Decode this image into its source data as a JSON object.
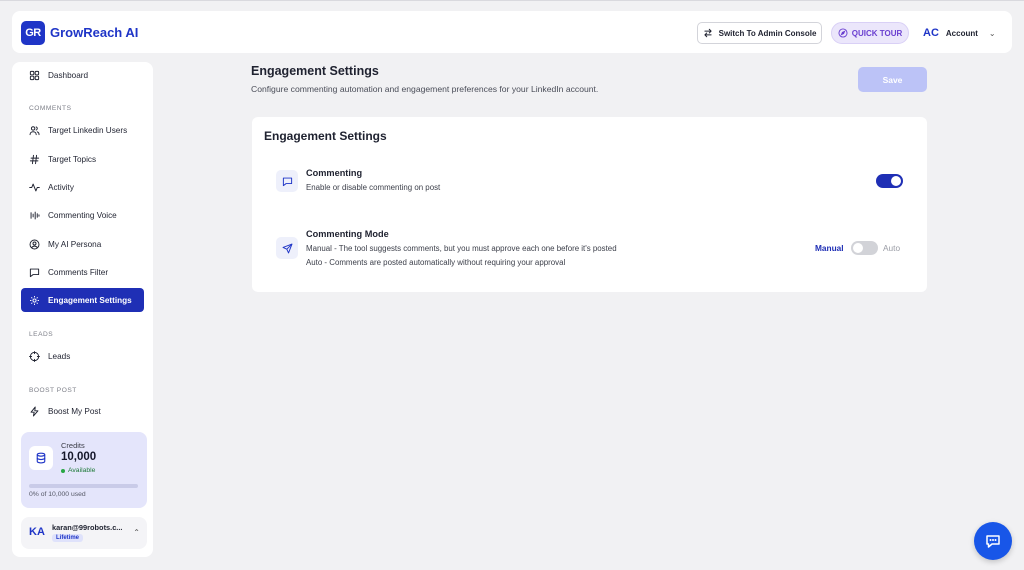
{
  "header": {
    "logo_text": "GR",
    "app_name": "GrowReach AI",
    "admin_console_label": "Switch To Admin Console",
    "quick_tour_label": "QUICK TOUR",
    "account_initials": "AC",
    "account_label": "Account"
  },
  "sidebar": {
    "dashboard": "Dashboard",
    "sections": {
      "comments": "COMMENTS",
      "leads": "LEADS",
      "boost": "BOOST POST"
    },
    "items": {
      "target_users": "Target Linkedin Users",
      "target_topics": "Target Topics",
      "activity": "Activity",
      "commenting_voice": "Commenting Voice",
      "ai_persona": "My AI Persona",
      "comments_filter": "Comments Filter",
      "engagement_settings": "Engagement Settings",
      "leads": "Leads",
      "boost_my_post": "Boost My Post"
    },
    "credits": {
      "title": "Credits",
      "value": "10,000",
      "status": "Available",
      "usage_text": "0% of 10,000 used",
      "usage_fraction": 0.0
    },
    "user": {
      "initials": "KA",
      "email": "karan@99robots.c...",
      "plan": "Lifetime"
    }
  },
  "main": {
    "title": "Engagement Settings",
    "subtitle": "Configure commenting automation and engagement preferences for your LinkedIn account.",
    "save_label": "Save",
    "card": {
      "title": "Engagement Settings",
      "commenting": {
        "title": "Commenting",
        "description": "Enable or disable commenting on post",
        "enabled": true
      },
      "mode": {
        "title": "Commenting Mode",
        "line1": "Manual - The tool suggests comments, but you must approve each one before it's posted",
        "line2": "Auto - Comments are posted automatically without requiring your approval",
        "manual_label": "Manual",
        "auto_label": "Auto",
        "selected": "Manual"
      }
    }
  },
  "colors": {
    "primary": "#1f2fb5",
    "brand": "#1f35c7",
    "save_disabled": "#bcc3f7",
    "chat_fab": "#1856e8"
  }
}
